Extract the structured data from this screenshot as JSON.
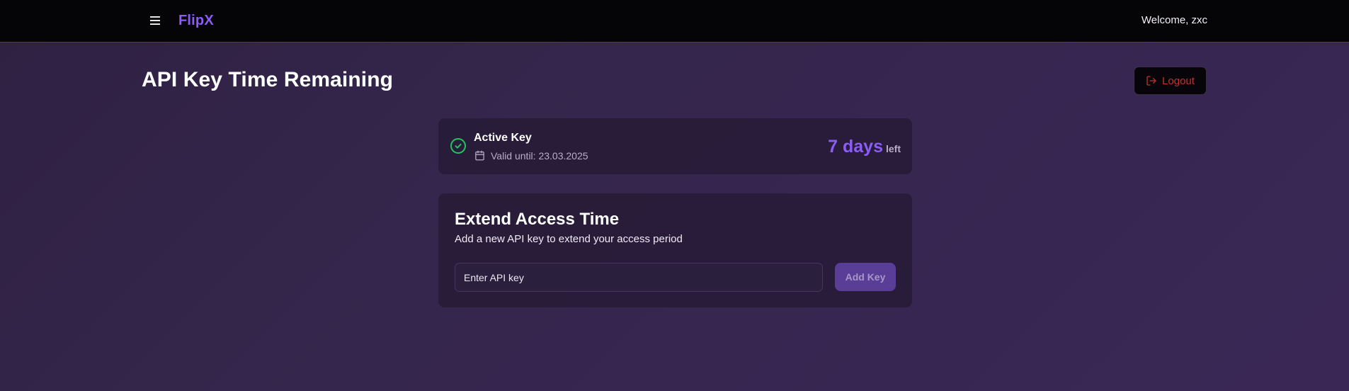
{
  "header": {
    "brand": "FlipX",
    "welcome": "Welcome, zxc",
    "menu_icon": "hamburger-menu-icon"
  },
  "page": {
    "title": "API Key Time Remaining",
    "logout_label": "Logout",
    "logout_icon": "logout-icon"
  },
  "active_key": {
    "title": "Active Key",
    "valid_until": "Valid until: 23.03.2025",
    "days_value": "7 days",
    "days_suffix": "left",
    "status_icon": "check-circle-icon",
    "calendar_icon": "calendar-icon"
  },
  "extend": {
    "title": "Extend Access Time",
    "description": "Add a new API key to extend your access period",
    "input_placeholder": "Enter API key",
    "input_value": "",
    "button_label": "Add Key"
  },
  "colors": {
    "accent": "#8b5cf6",
    "success": "#22c55e",
    "danger": "#c23030",
    "background": "#362651",
    "topbar": "#050407",
    "card": "#261b36",
    "button": "#5a3d96"
  }
}
